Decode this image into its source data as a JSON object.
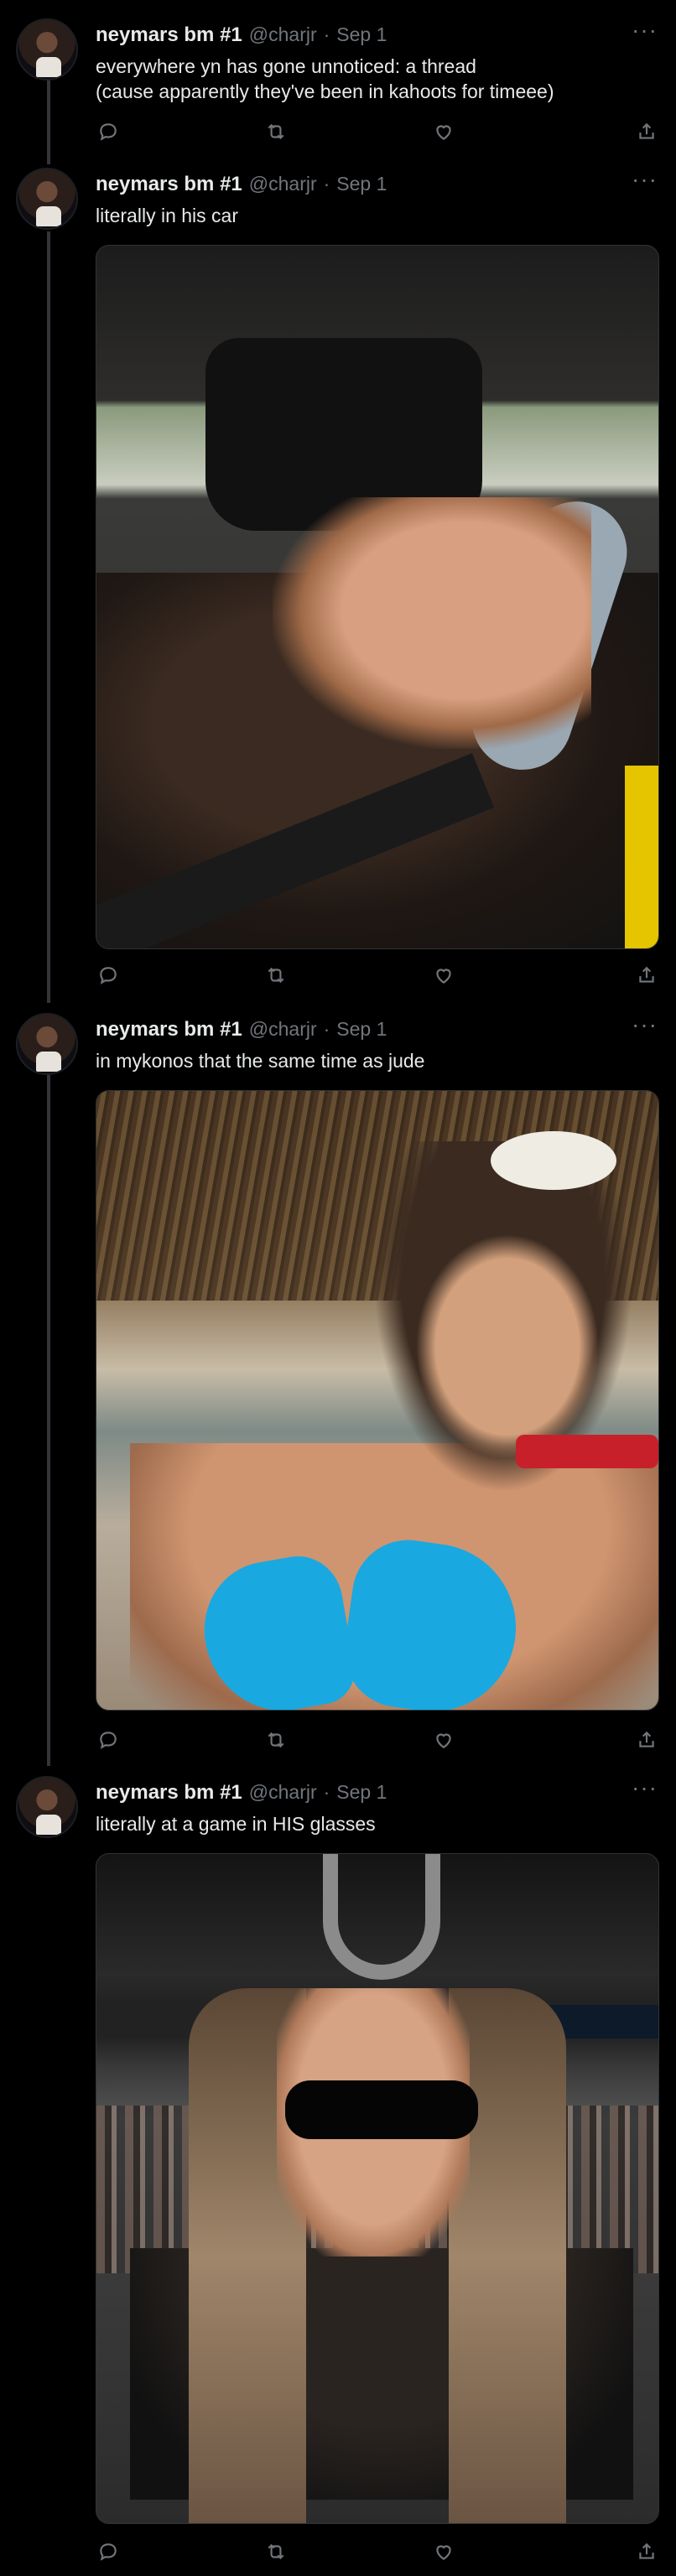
{
  "tweets": [
    {
      "name": "neymars bm #1",
      "handle": "@charjr",
      "separator": "·",
      "date": "Sep 1",
      "more": "···",
      "text": "everywhere yn has gone unnoticed: a thread\n(cause apparently they've been in kahoots for timeee)",
      "has_media": false
    },
    {
      "name": "neymars bm #1",
      "handle": "@charjr",
      "separator": "·",
      "date": "Sep 1",
      "more": "···",
      "text": "literally in his car",
      "has_media": true
    },
    {
      "name": "neymars bm #1",
      "handle": "@charjr",
      "separator": "·",
      "date": "Sep 1",
      "more": "···",
      "text": "in mykonos that the same time as jude",
      "has_media": true
    },
    {
      "name": "neymars bm #1",
      "handle": "@charjr",
      "separator": "·",
      "date": "Sep 1",
      "more": "···",
      "text": "literally at a game in HIS glasses",
      "has_media": true
    }
  ],
  "icons": {
    "reply": "reply-icon",
    "retweet": "retweet-icon",
    "like": "heart-icon",
    "share": "share-icon"
  },
  "colors": {
    "background": "#000000",
    "text": "#e7e9ea",
    "secondary": "#71767b",
    "thread_line": "#333639"
  }
}
